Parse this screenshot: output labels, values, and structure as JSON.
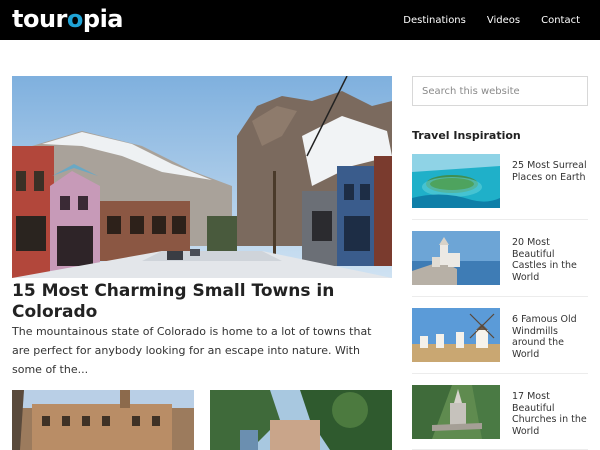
{
  "header": {
    "logo": {
      "part1": "tour",
      "part2": "o",
      "part3": "pia"
    },
    "nav": [
      "Destinations",
      "Videos",
      "Contact"
    ]
  },
  "feature": {
    "title": "15 Most Charming Small Towns in Colorado",
    "excerpt": "The mountainous state of Colorado is home to a lot of towns that are perfect for anybody looking for an escape into nature. With some of the..."
  },
  "sidebar": {
    "search_placeholder": "Search this website",
    "heading": "Travel Inspiration",
    "items": [
      {
        "label": "25 Most Surreal Places on Earth"
      },
      {
        "label": "20 Most Beautiful Castles in the World"
      },
      {
        "label": "6 Famous Old Windmills around the World"
      },
      {
        "label": "17 Most Beautiful Churches in the World"
      }
    ]
  },
  "colors": {
    "brand_blue": "#1fa3d6",
    "header_bg": "#000000"
  }
}
